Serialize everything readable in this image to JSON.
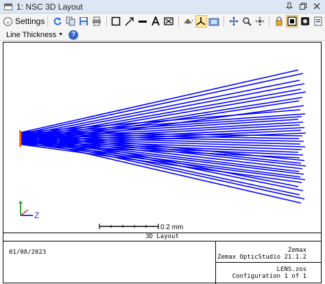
{
  "window": {
    "title": "1: NSC 3D Layout",
    "controls": [
      "pin-icon",
      "restore-icon",
      "close-icon"
    ]
  },
  "toolbar": {
    "settings_label": "Settings",
    "icons": [
      "refresh-icon",
      "copy-icon",
      "save-icon",
      "print-icon",
      "rectangle-icon",
      "arrow-icon",
      "line-icon",
      "text-icon",
      "erase-icon",
      "rotate-icon",
      "axes-icon",
      "camera-icon",
      "pan-icon",
      "zoom-icon",
      "scroll-icon",
      "lock-icon",
      "window-icon",
      "display-icon",
      "export-icon"
    ],
    "line_thickness_label": "Line Thickness",
    "active_tool": "axes-icon"
  },
  "plot": {
    "ray_color": "#0000ff",
    "source_color": "#ff6a00",
    "axis_label_z": "Z",
    "axis_label_x": "X",
    "axis_label_y": "Y",
    "scale_label": "0.2 mm"
  },
  "footer": {
    "caption": "3D Layout",
    "date": "01/08/2023",
    "company": "Zemax",
    "product": "Zemax OpticStudio 21.1.2",
    "file": "LENS.zos",
    "configuration": "Configuration 1 of 1"
  }
}
